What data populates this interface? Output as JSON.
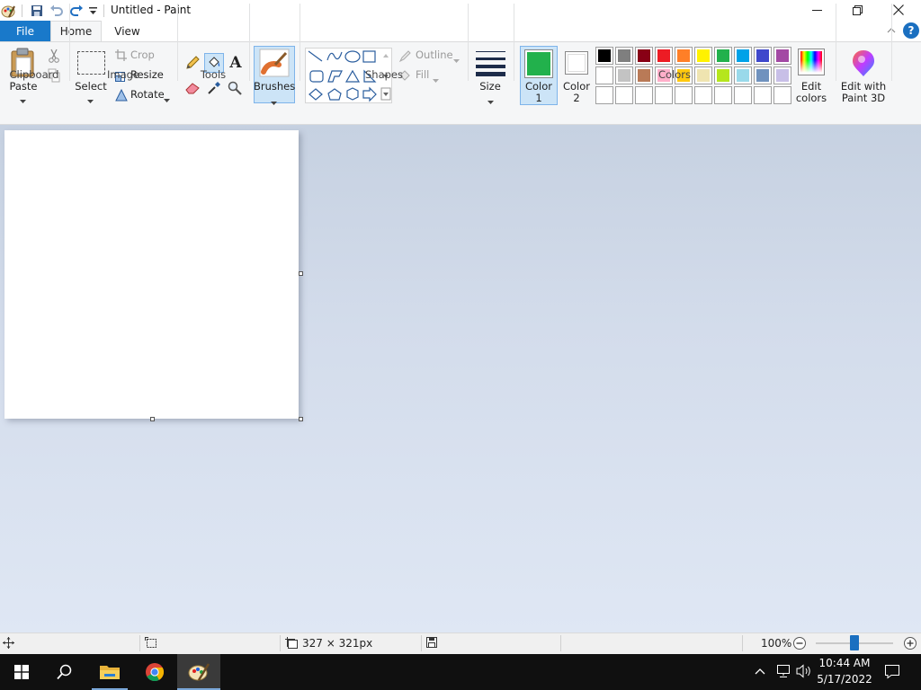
{
  "window": {
    "title": "Untitled - Paint"
  },
  "tabs": {
    "file": "File",
    "home": "Home",
    "view": "View"
  },
  "ribbon": {
    "clipboard": {
      "paste": "Paste",
      "group": "Clipboard"
    },
    "image": {
      "select": "Select",
      "crop": "Crop",
      "resize": "Resize",
      "rotate": "Rotate",
      "group": "Image"
    },
    "tools": {
      "group": "Tools"
    },
    "brushes": {
      "label": "Brushes"
    },
    "shapes": {
      "outline": "Outline",
      "fill": "Fill",
      "group": "Shapes"
    },
    "size": {
      "label": "Size"
    },
    "color1": {
      "line1": "Color",
      "line2": "1",
      "value": "#22b14c"
    },
    "color2": {
      "line1": "Color",
      "line2": "2",
      "value": "#ffffff"
    },
    "colors": {
      "group": "Colors",
      "row1": [
        "#000000",
        "#7f7f7f",
        "#880015",
        "#ed1c24",
        "#ff7f27",
        "#fff200",
        "#22b14c",
        "#00a2e8",
        "#3f48cc",
        "#a349a4"
      ],
      "row2": [
        "#ffffff",
        "#c3c3c3",
        "#b97a57",
        "#ffaec9",
        "#ffc90e",
        "#efe4b0",
        "#b5e61d",
        "#99d9ea",
        "#7092be",
        "#c8bfe7"
      ],
      "row3": [
        "#ffffff",
        "#ffffff",
        "#ffffff",
        "#ffffff",
        "#ffffff",
        "#ffffff",
        "#ffffff",
        "#ffffff",
        "#ffffff",
        "#ffffff"
      ]
    },
    "edit_colors": {
      "line1": "Edit",
      "line2": "colors"
    },
    "paint3d": {
      "line1": "Edit with",
      "line2": "Paint 3D"
    }
  },
  "status": {
    "canvas_size": "327 × 321px",
    "zoom": "100%",
    "zoom_fraction": 0.5
  },
  "taskbar": {
    "time": "10:44 AM",
    "date": "5/17/2022"
  }
}
